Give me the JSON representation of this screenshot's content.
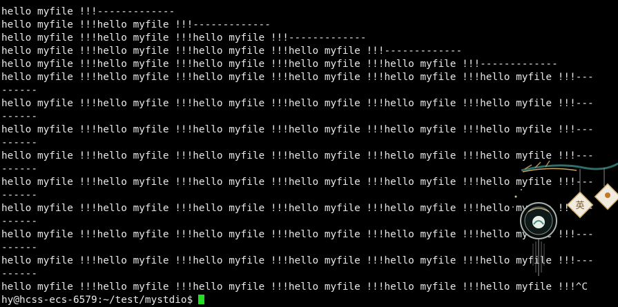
{
  "terminal": {
    "lines": [
      "-------------",
      "hello myfile !!!-------------",
      "hello myfile !!!hello myfile !!!-------------",
      "hello myfile !!!hello myfile !!!hello myfile !!!-------------",
      "hello myfile !!!hello myfile !!!hello myfile !!!hello myfile !!!-------------",
      "hello myfile !!!hello myfile !!!hello myfile !!!hello myfile !!!hello myfile !!!-------------",
      "hello myfile !!!hello myfile !!!hello myfile !!!hello myfile !!!hello myfile !!!hello myfile !!!---",
      "------",
      "hello myfile !!!hello myfile !!!hello myfile !!!hello myfile !!!hello myfile !!!hello myfile !!!---",
      "------",
      "hello myfile !!!hello myfile !!!hello myfile !!!hello myfile !!!hello myfile !!!hello myfile !!!---",
      "------",
      "hello myfile !!!hello myfile !!!hello myfile !!!hello myfile !!!hello myfile !!!hello myfile !!!---",
      "------",
      "hello myfile !!!hello myfile !!!hello myfile !!!hello myfile !!!hello myfile !!!hello myfile !!!---",
      "------",
      "hello myfile !!!hello myfile !!!hello myfile !!!hello myfile !!!hello myfile !!!hello myfile !!!---",
      "------",
      "hello myfile !!!hello myfile !!!hello myfile !!!hello myfile !!!hello myfile !!!hello myfile !!!---",
      "------",
      "hello myfile !!!hello myfile !!!hello myfile !!!hello myfile !!!hello myfile !!!hello myfile !!!---",
      "------",
      "hello myfile !!!hello myfile !!!hello myfile !!!hello myfile !!!hello myfile !!!hello myfile !!!^C"
    ],
    "prompt": "hy@hcss-ecs-6579:~/test/mystdio$",
    "colors": {
      "background": "#000000",
      "text": "#e8e8e8",
      "cursor": "#22dd22"
    },
    "decoration_icon": "hanging-ornament-icon"
  }
}
